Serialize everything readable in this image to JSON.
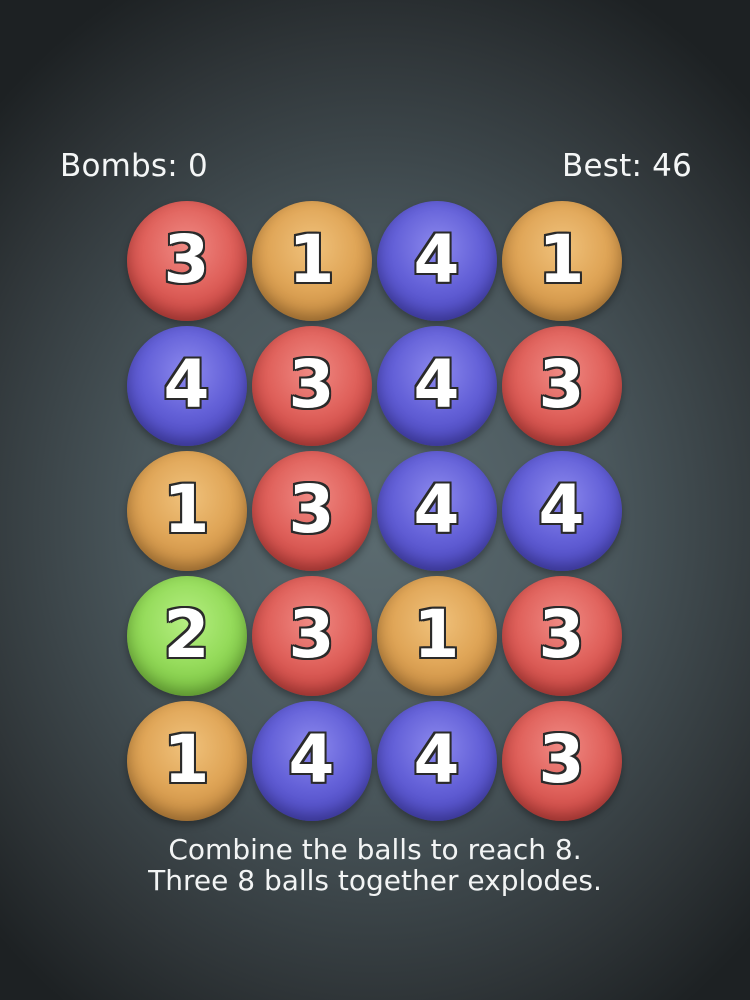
{
  "hud": {
    "bombs_label": "Bombs: 0",
    "best_label": "Best: 46"
  },
  "board": {
    "rows": [
      [
        3,
        1,
        4,
        1
      ],
      [
        4,
        3,
        4,
        3
      ],
      [
        1,
        3,
        4,
        4
      ],
      [
        2,
        3,
        1,
        3
      ],
      [
        1,
        4,
        4,
        3
      ]
    ],
    "ball_colors": {
      "1": "#e0a658",
      "2": "#96dc5c",
      "3": "#e0625c",
      "4": "#6461d8"
    }
  },
  "instructions": {
    "line1": "Combine the balls to reach 8.",
    "line2": "Three 8 balls together explodes."
  }
}
